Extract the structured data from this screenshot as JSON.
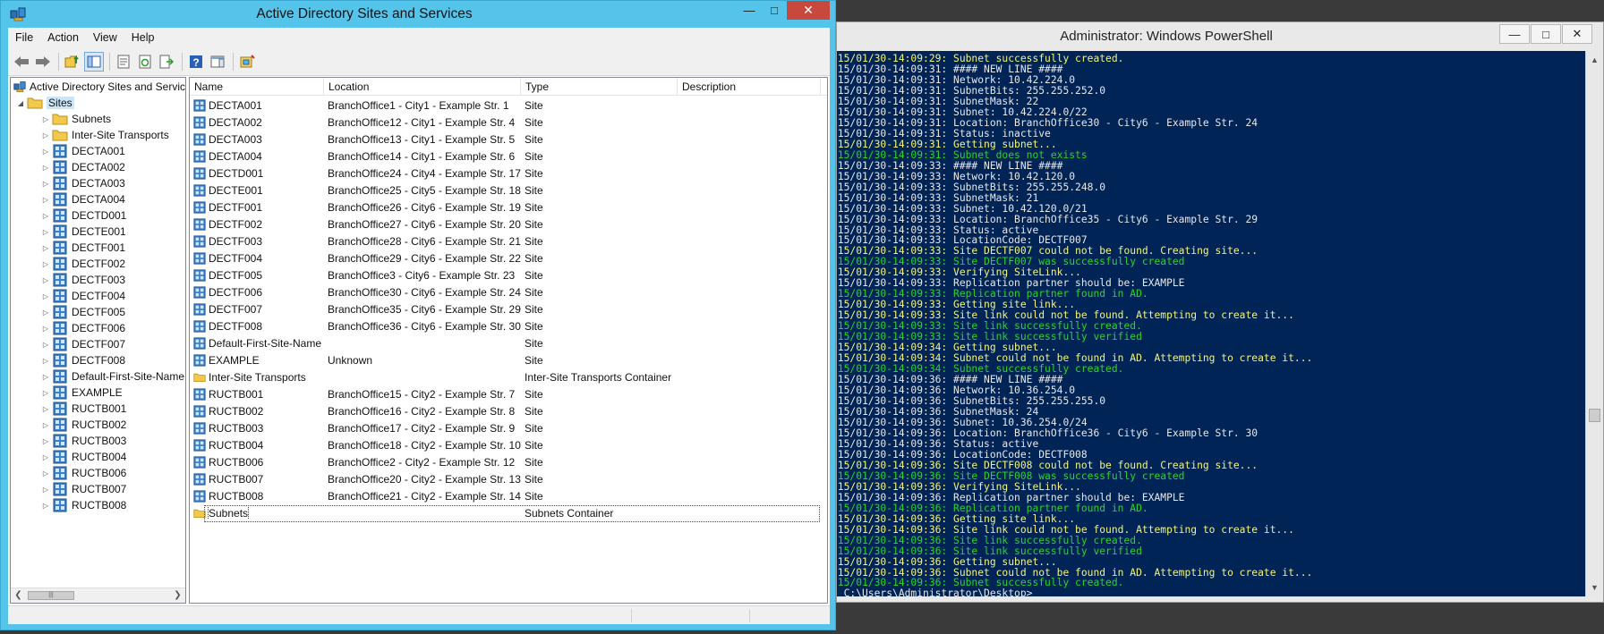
{
  "ad": {
    "title": "Active Directory Sites and Services",
    "menu": [
      "File",
      "Action",
      "View",
      "Help"
    ],
    "toolbar_icons": [
      "back-arrow-icon",
      "forward-arrow-icon",
      "up-folder-icon",
      "show-hide-tree-icon",
      "properties-icon",
      "refresh-icon",
      "export-list-icon",
      "help-icon",
      "action-pane-icon",
      "new-site-icon"
    ],
    "tree": {
      "root": "Active Directory Sites and Servic",
      "sites_label": "Sites",
      "children": [
        "Subnets",
        "Inter-Site Transports",
        "DECTA001",
        "DECTA002",
        "DECTA003",
        "DECTA004",
        "DECTD001",
        "DECTE001",
        "DECTF001",
        "DECTF002",
        "DECTF003",
        "DECTF004",
        "DECTF005",
        "DECTF006",
        "DECTF007",
        "DECTF008",
        "Default-First-Site-Name",
        "EXAMPLE",
        "RUCTB001",
        "RUCTB002",
        "RUCTB003",
        "RUCTB004",
        "RUCTB006",
        "RUCTB007",
        "RUCTB008"
      ],
      "folder_children": [
        "Subnets",
        "Inter-Site Transports"
      ]
    },
    "list": {
      "columns": [
        "Name",
        "Location",
        "Type",
        "Description"
      ],
      "rows": [
        {
          "name": "DECTA001",
          "location": "BranchOffice1 - City1 - Example Str. 1",
          "type": "Site",
          "icon": "site"
        },
        {
          "name": "DECTA002",
          "location": "BranchOffice12 - City1 - Example Str. 4",
          "type": "Site",
          "icon": "site"
        },
        {
          "name": "DECTA003",
          "location": "BranchOffice13 - City1 - Example Str. 5",
          "type": "Site",
          "icon": "site"
        },
        {
          "name": "DECTA004",
          "location": "BranchOffice14 - City1 - Example Str. 6",
          "type": "Site",
          "icon": "site"
        },
        {
          "name": "DECTD001",
          "location": "BranchOffice24 - City4 - Example Str. 17",
          "type": "Site",
          "icon": "site"
        },
        {
          "name": "DECTE001",
          "location": "BranchOffice25 - City5 - Example Str. 18",
          "type": "Site",
          "icon": "site"
        },
        {
          "name": "DECTF001",
          "location": "BranchOffice26 - City6 - Example Str. 19",
          "type": "Site",
          "icon": "site"
        },
        {
          "name": "DECTF002",
          "location": "BranchOffice27 - City6 - Example Str. 20",
          "type": "Site",
          "icon": "site"
        },
        {
          "name": "DECTF003",
          "location": "BranchOffice28 - City6 - Example Str. 21",
          "type": "Site",
          "icon": "site"
        },
        {
          "name": "DECTF004",
          "location": "BranchOffice29 - City6 - Example Str. 22",
          "type": "Site",
          "icon": "site"
        },
        {
          "name": "DECTF005",
          "location": "BranchOffice3 - City6 - Example Str. 23",
          "type": "Site",
          "icon": "site"
        },
        {
          "name": "DECTF006",
          "location": "BranchOffice30 - City6 - Example Str. 24",
          "type": "Site",
          "icon": "site"
        },
        {
          "name": "DECTF007",
          "location": "BranchOffice35 - City6 - Example Str. 29",
          "type": "Site",
          "icon": "site"
        },
        {
          "name": "DECTF008",
          "location": "BranchOffice36 - City6 - Example Str. 30",
          "type": "Site",
          "icon": "site"
        },
        {
          "name": "Default-First-Site-Name",
          "location": "",
          "type": "Site",
          "icon": "site"
        },
        {
          "name": "EXAMPLE",
          "location": "Unknown",
          "type": "Site",
          "icon": "site"
        },
        {
          "name": "Inter-Site Transports",
          "location": "",
          "type": "Inter-Site Transports Container",
          "icon": "folder"
        },
        {
          "name": "RUCTB001",
          "location": "BranchOffice15 - City2 - Example Str. 7",
          "type": "Site",
          "icon": "site"
        },
        {
          "name": "RUCTB002",
          "location": "BranchOffice16 - City2 - Example Str. 8",
          "type": "Site",
          "icon": "site"
        },
        {
          "name": "RUCTB003",
          "location": "BranchOffice17 - City2 - Example Str. 9",
          "type": "Site",
          "icon": "site"
        },
        {
          "name": "RUCTB004",
          "location": "BranchOffice18 - City2 - Example Str. 10",
          "type": "Site",
          "icon": "site"
        },
        {
          "name": "RUCTB006",
          "location": "BranchOffice2 - City2 - Example Str. 12",
          "type": "Site",
          "icon": "site"
        },
        {
          "name": "RUCTB007",
          "location": "BranchOffice20 - City2 - Example Str. 13",
          "type": "Site",
          "icon": "site"
        },
        {
          "name": "RUCTB008",
          "location": "BranchOffice21 - City2 - Example Str. 14",
          "type": "Site",
          "icon": "site"
        },
        {
          "name": "Subnets",
          "location": "",
          "type": "Subnets Container",
          "icon": "folder",
          "focused": true
        }
      ]
    }
  },
  "ps": {
    "title": "Administrator: Windows PowerShell",
    "lines": [
      {
        "t": "015/01/30-14:09:29: Subnet successfully created.",
        "c": "yellow"
      },
      {
        "t": "015/01/30-14:09:31: #### NEW LINE ####",
        "c": "white"
      },
      {
        "t": "015/01/30-14:09:31: Network: 10.42.224.0",
        "c": "white"
      },
      {
        "t": "015/01/30-14:09:31: SubnetBits: 255.255.252.0",
        "c": "white"
      },
      {
        "t": "015/01/30-14:09:31: SubnetMask: 22",
        "c": "white"
      },
      {
        "t": "015/01/30-14:09:31: Subnet: 10.42.224.0/22",
        "c": "white"
      },
      {
        "t": "015/01/30-14:09:31: Location: BranchOffice30 - City6 - Example Str. 24",
        "c": "white"
      },
      {
        "t": "015/01/30-14:09:31: Status: inactive",
        "c": "white"
      },
      {
        "t": "015/01/30-14:09:31: Getting subnet...",
        "c": "yellow"
      },
      {
        "t": "015/01/30-14:09:31: Subnet does not exists",
        "c": "green"
      },
      {
        "t": "015/01/30-14:09:33: #### NEW LINE ####",
        "c": "white"
      },
      {
        "t": "015/01/30-14:09:33: Network: 10.42.120.0",
        "c": "white"
      },
      {
        "t": "015/01/30-14:09:33: SubnetBits: 255.255.248.0",
        "c": "white"
      },
      {
        "t": "015/01/30-14:09:33: SubnetMask: 21",
        "c": "white"
      },
      {
        "t": "015/01/30-14:09:33: Subnet: 10.42.120.0/21",
        "c": "white"
      },
      {
        "t": "015/01/30-14:09:33: Location: BranchOffice35 - City6 - Example Str. 29",
        "c": "white"
      },
      {
        "t": "015/01/30-14:09:33: Status: active",
        "c": "white"
      },
      {
        "t": "015/01/30-14:09:33: LocationCode: DECTF007",
        "c": "white"
      },
      {
        "t": "015/01/30-14:09:33: Site DECTF007 could not be found. Creating site...",
        "c": "yellow"
      },
      {
        "t": "015/01/30-14:09:33: Site DECTF007 was successfully created",
        "c": "green"
      },
      {
        "t": "015/01/30-14:09:33: Verifying SiteLink...",
        "c": "yellow"
      },
      {
        "t": "015/01/30-14:09:33: Replication partner should be: EXAMPLE",
        "c": "white"
      },
      {
        "t": "015/01/30-14:09:33: Replication partner found in AD.",
        "c": "green"
      },
      {
        "t": "015/01/30-14:09:33: Getting site link...",
        "c": "yellow"
      },
      {
        "t": "015/01/30-14:09:33: Site link could not be found. Attempting to create it...",
        "c": "yellow"
      },
      {
        "t": "015/01/30-14:09:33: Site link successfully created.",
        "c": "green"
      },
      {
        "t": "015/01/30-14:09:33: Site link successfully verified",
        "c": "green"
      },
      {
        "t": "015/01/30-14:09:34: Getting subnet...",
        "c": "yellow"
      },
      {
        "t": "015/01/30-14:09:34: Subnet could not be found in AD. Attempting to create it...",
        "c": "yellow"
      },
      {
        "t": "015/01/30-14:09:34: Subnet successfully created.",
        "c": "green"
      },
      {
        "t": "015/01/30-14:09:36: #### NEW LINE ####",
        "c": "white"
      },
      {
        "t": "015/01/30-14:09:36: Network: 10.36.254.0",
        "c": "white"
      },
      {
        "t": "015/01/30-14:09:36: SubnetBits: 255.255.255.0",
        "c": "white"
      },
      {
        "t": "015/01/30-14:09:36: SubnetMask: 24",
        "c": "white"
      },
      {
        "t": "015/01/30-14:09:36: Subnet: 10.36.254.0/24",
        "c": "white"
      },
      {
        "t": "015/01/30-14:09:36: Location: BranchOffice36 - City6 - Example Str. 30",
        "c": "white"
      },
      {
        "t": "015/01/30-14:09:36: Status: active",
        "c": "white"
      },
      {
        "t": "015/01/30-14:09:36: LocationCode: DECTF008",
        "c": "white"
      },
      {
        "t": "015/01/30-14:09:36: Site DECTF008 could not be found. Creating site...",
        "c": "yellow"
      },
      {
        "t": "015/01/30-14:09:36: Site DECTF008 was successfully created",
        "c": "green"
      },
      {
        "t": "015/01/30-14:09:36: Verifying SiteLink...",
        "c": "yellow"
      },
      {
        "t": "015/01/30-14:09:36: Replication partner should be: EXAMPLE",
        "c": "white"
      },
      {
        "t": "015/01/30-14:09:36: Replication partner found in AD.",
        "c": "green"
      },
      {
        "t": "015/01/30-14:09:36: Getting site link...",
        "c": "yellow"
      },
      {
        "t": "015/01/30-14:09:36: Site link could not be found. Attempting to create it...",
        "c": "yellow"
      },
      {
        "t": "015/01/30-14:09:36: Site link successfully created.",
        "c": "green"
      },
      {
        "t": "015/01/30-14:09:36: Site link successfully verified",
        "c": "green"
      },
      {
        "t": "015/01/30-14:09:36: Getting subnet...",
        "c": "yellow"
      },
      {
        "t": "015/01/30-14:09:36: Subnet could not be found in AD. Attempting to create it...",
        "c": "yellow"
      },
      {
        "t": "015/01/30-14:09:36: Subnet successfully created.",
        "c": "green"
      },
      {
        "t": "S C:\\Users\\Administrator\\Desktop>",
        "c": "white"
      }
    ]
  },
  "colors": {
    "ad_frame": "#55c4ea",
    "ad_close": "#c9483e",
    "ps_background": "#012456",
    "ps_white": "#e8e8e8",
    "ps_yellow": "#f5f57a",
    "ps_green": "#2cd42c"
  }
}
